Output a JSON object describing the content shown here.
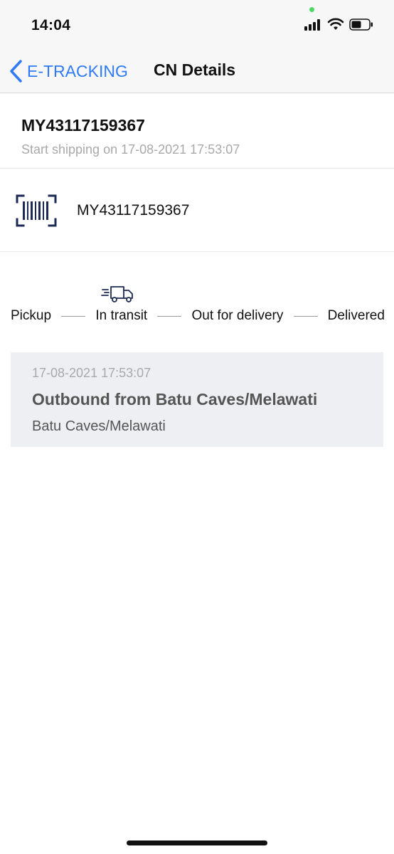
{
  "status_bar": {
    "time": "14:04",
    "icons": [
      "signal-icon",
      "wifi-icon",
      "battery-icon"
    ]
  },
  "nav": {
    "back_label": "E-TRACKING",
    "title": "CN Details"
  },
  "shipment": {
    "cn_number": "MY43117159367",
    "start_text": "Start shipping on 17-08-2021 17:53:07",
    "barcode_number": "MY43117159367"
  },
  "progress": {
    "steps": [
      "Pickup",
      "In transit",
      "Out for delivery",
      "Delivered"
    ],
    "current_step": "In transit"
  },
  "events": [
    {
      "time": "17-08-2021 17:53:07",
      "title": "Outbound from Batu Caves/Melawati",
      "location": "Batu Caves/Melawati"
    }
  ],
  "colors": {
    "accent": "#2f7bf5",
    "navy_icon": "#1c2a55",
    "muted_text": "#a9a9a9",
    "card_bg": "#eeeff2"
  }
}
